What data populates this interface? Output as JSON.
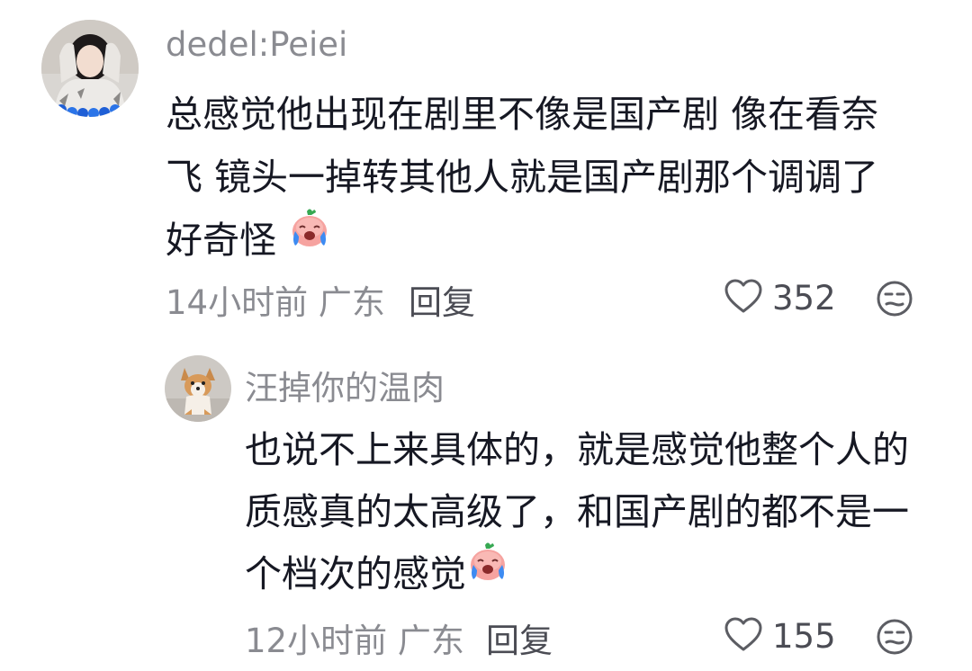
{
  "comments": [
    {
      "username": "dedel:Peiei",
      "lines": [
        "总感觉他出现在剧里不像是国产剧  像在看奈",
        "飞    镜头一掉转其他人就是国产剧那个调调了",
        "好奇怪  "
      ],
      "emoji": "crying-face-emoji",
      "time_location": "14小时前 广东",
      "reply_label": "回复",
      "like_count": "352",
      "avatar_icon": "user-avatar-woman"
    },
    {
      "username": "汪掉你的温肉",
      "lines": [
        "也说不上来具体的，就是感觉他整个人的",
        "质感真的太高级了，和国产剧的都不是一",
        "个档次的感觉"
      ],
      "emoji": "crying-face-emoji",
      "time_location": "12小时前 广东",
      "reply_label": "回复",
      "like_count": "155",
      "avatar_icon": "user-avatar-dog"
    }
  ],
  "colors": {
    "text": "#161823",
    "secondary": "#8a8b91",
    "action": "#4b4c54",
    "emoji_face": "#f6a3a0",
    "emoji_tear": "#3d8bf2"
  }
}
